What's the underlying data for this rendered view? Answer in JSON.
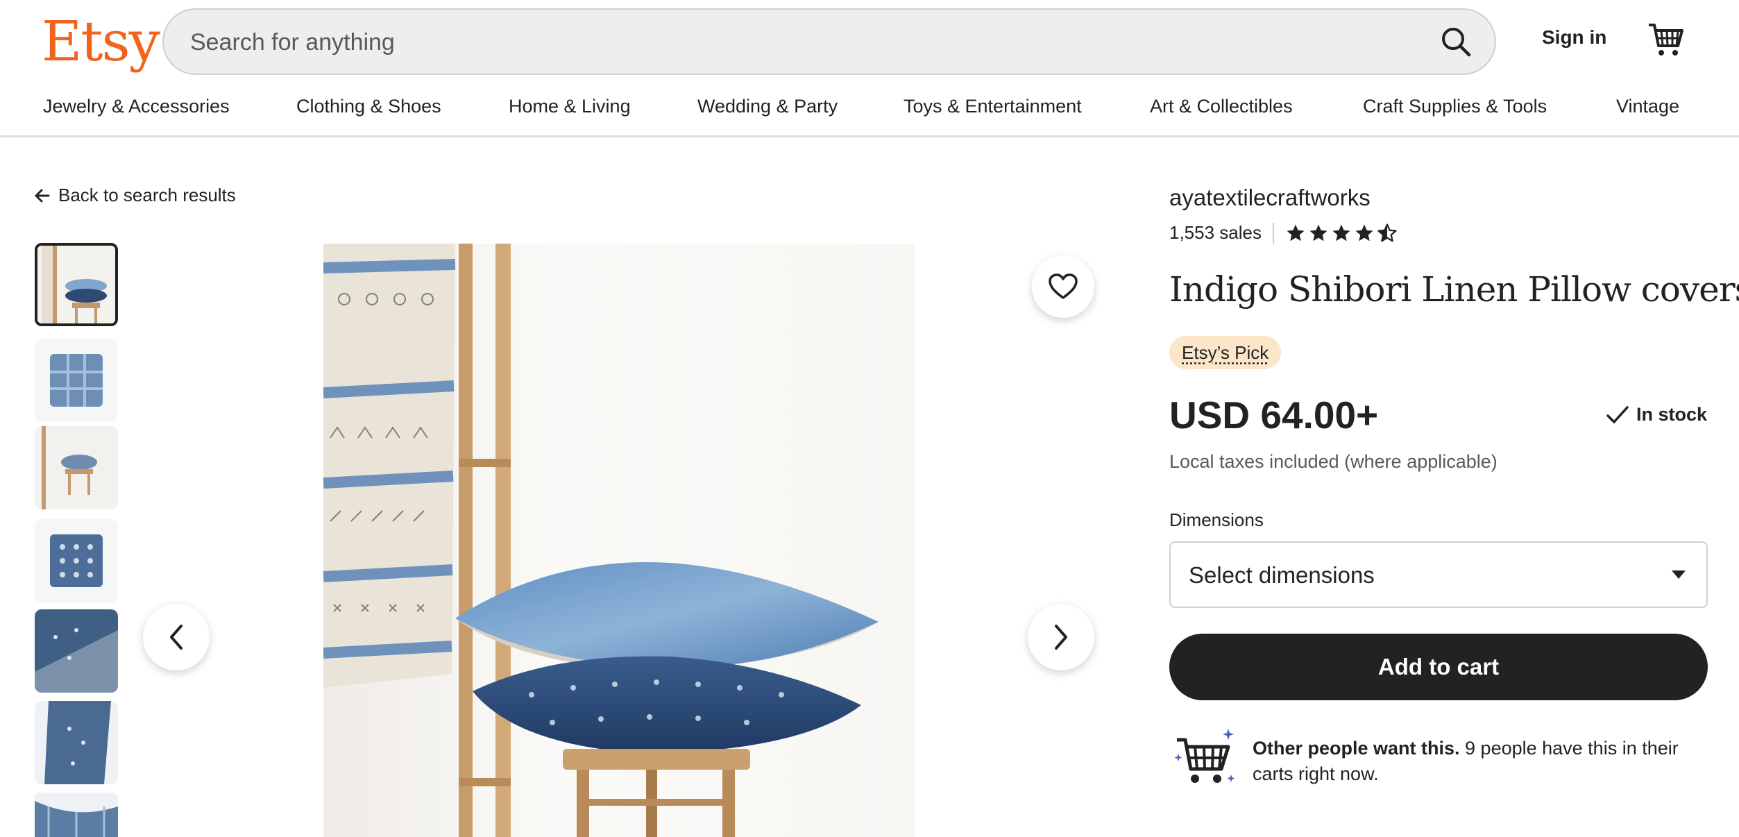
{
  "header": {
    "logo": "Etsy",
    "search_placeholder": "Search for anything",
    "sign_in": "Sign in"
  },
  "nav": {
    "items": [
      "Jewelry & Accessories",
      "Clothing & Shoes",
      "Home & Living",
      "Wedding & Party",
      "Toys & Entertainment",
      "Art & Collectibles",
      "Craft Supplies & Tools",
      "Vintage"
    ]
  },
  "back_link": "Back to search results",
  "product": {
    "shop_name": "ayatextilecraftworks",
    "sales": "1,553 sales",
    "rating": 4.5,
    "title": "Indigo Shibori Linen Pillow covers",
    "badge": "Etsy’s Pick",
    "price": "USD 64.00+",
    "stock": "In stock",
    "taxes": "Local taxes included (where applicable)",
    "dimensions_label": "Dimensions",
    "dimensions_placeholder": "Select dimensions",
    "add_to_cart": "Add to cart",
    "promo_bold": "Other people want this.",
    "promo_rest": " 9 people have this in their carts right now."
  },
  "colors": {
    "brand": "#f1641e",
    "badge_bg": "#fce6c9",
    "button_bg": "#222222"
  },
  "icons": [
    "search-icon",
    "cart-icon",
    "arrow-left-icon",
    "heart-icon",
    "chevron-left-icon",
    "chevron-right-icon",
    "star-icon",
    "checkmark-icon",
    "cart-sparkle-icon"
  ]
}
